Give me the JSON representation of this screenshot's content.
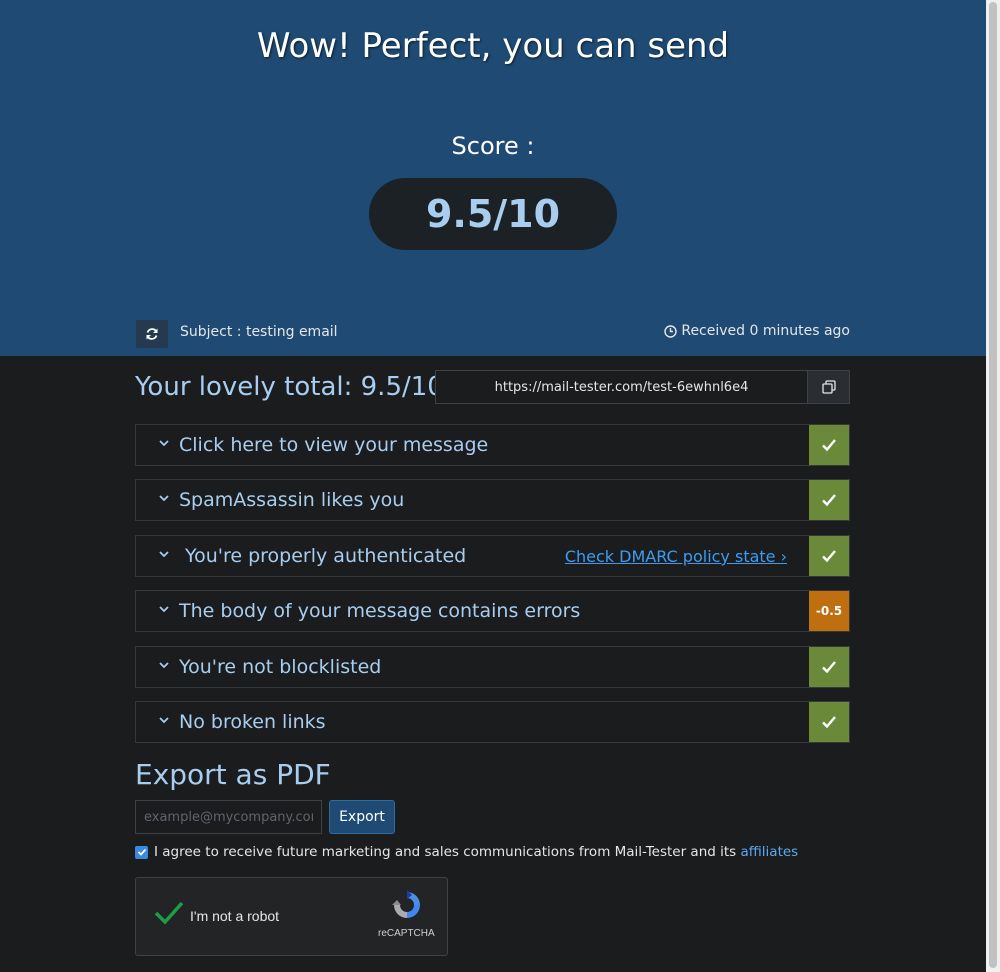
{
  "hero": {
    "title": "Wow! Perfect, you can send",
    "score_label": "Score :",
    "score_value": "9.5/10",
    "subject": "Subject : testing email",
    "received": "Received 0 minutes ago"
  },
  "summary": {
    "total_title": "Your lovely total: 9.5/10",
    "test_url": "https://mail-tester.com/test-6ewhnl6e4"
  },
  "checks": [
    {
      "label": "Click here to view your message",
      "status": "ok",
      "badge": "✓"
    },
    {
      "label": "SpamAssassin likes you",
      "status": "ok",
      "badge": "✓"
    },
    {
      "label": "You're properly authenticated",
      "status": "ok",
      "badge": "✓",
      "link": "Check DMARC policy state ›"
    },
    {
      "label": "The body of your message contains errors",
      "status": "warn",
      "badge": "-0.5"
    },
    {
      "label": "You're not blocklisted",
      "status": "ok",
      "badge": "✓"
    },
    {
      "label": "No broken links",
      "status": "ok",
      "badge": "✓"
    }
  ],
  "export": {
    "title": "Export as PDF",
    "email_placeholder": "example@mycompany.com",
    "button_label": "Export",
    "agree_text": "I agree to receive future marketing and sales communications from Mail-Tester and its ",
    "agree_link": "affiliates",
    "agree_checked": true
  },
  "captcha": {
    "label": "I'm not a robot",
    "brand": "reCAPTCHA"
  },
  "colors": {
    "hero_bg": "#1e4a73",
    "accent_text": "#a8cdee",
    "ok_badge": "#6a8a3a",
    "warn_badge": "#c06f10",
    "link": "#3d9cf0"
  }
}
